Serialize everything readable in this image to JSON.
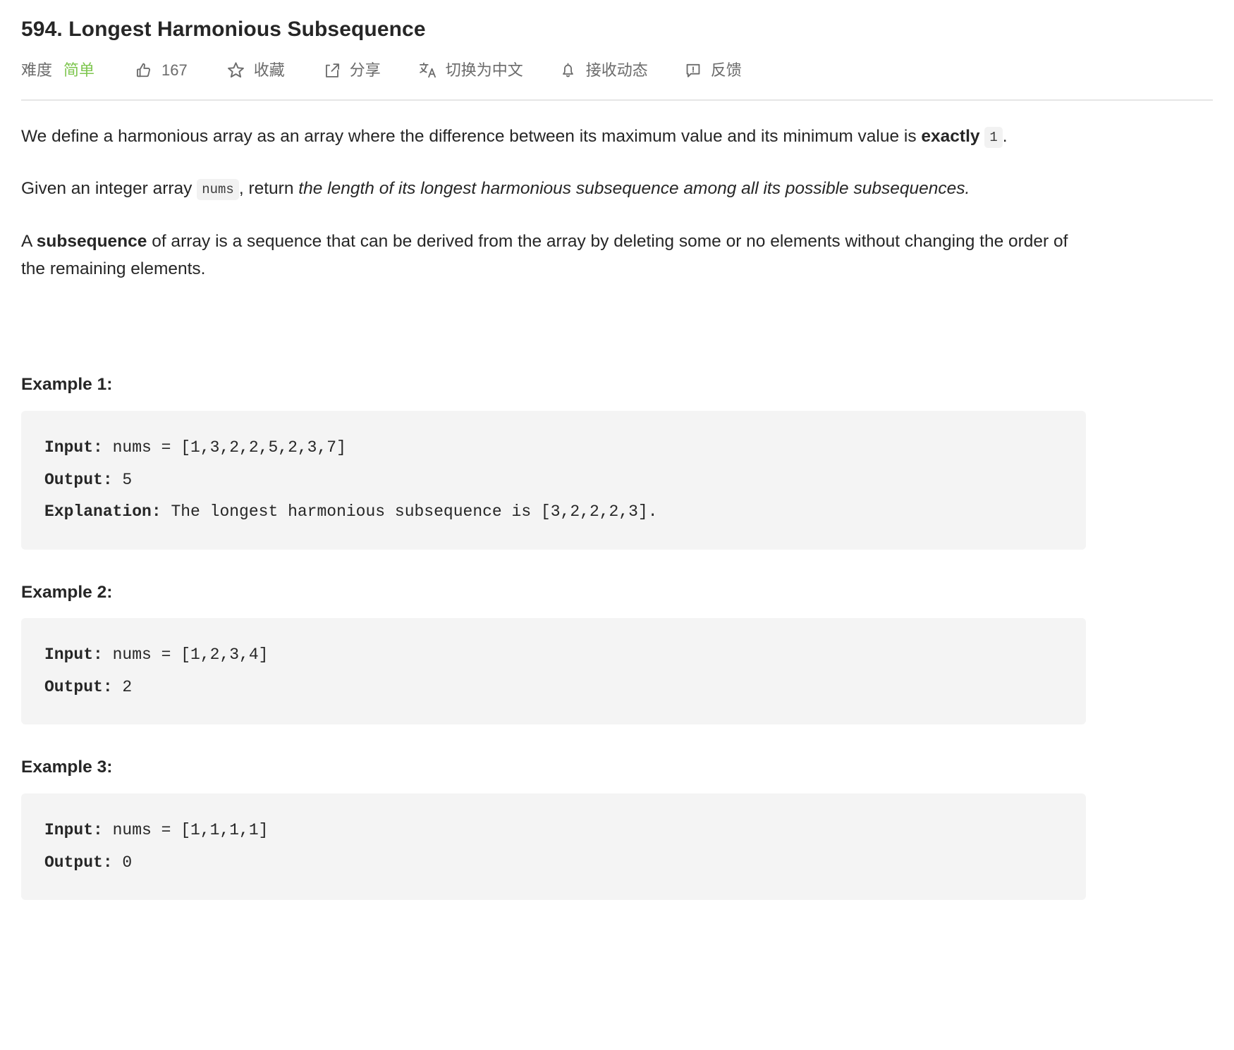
{
  "header": {
    "title": "594. Longest Harmonious Subsequence",
    "difficulty_label": "难度",
    "difficulty_value": "简单",
    "difficulty_color": "#7ec64f",
    "likes_count": "167",
    "favorite_label": "收藏",
    "share_label": "分享",
    "translate_label": "切换为中文",
    "subscribe_label": "接收动态",
    "feedback_label": "反馈",
    "icons": {
      "like": "thumbs-up-icon",
      "favorite": "star-icon",
      "share": "share-icon",
      "translate": "translate-icon",
      "subscribe": "bell-icon",
      "feedback": "feedback-icon"
    }
  },
  "content": {
    "paragraph_1_a": "We define a harmonious array as an array where the difference between its maximum value and its minimum value is ",
    "paragraph_1_bold": "exactly",
    "paragraph_1_code": "1",
    "paragraph_1_end": ".",
    "paragraph_2_a": "Given an integer array ",
    "paragraph_2_code": "nums",
    "paragraph_2_b": ", return ",
    "paragraph_2_em": "the length of its longest harmonious subsequence among all its possible subsequences.",
    "paragraph_3_a": "A ",
    "paragraph_3_bold": "subsequence",
    "paragraph_3_b": " of array is a sequence that can be derived from the array by deleting some or no elements without changing the order of the remaining elements."
  },
  "examples": [
    {
      "heading": "Example 1:",
      "input_label": "Input:",
      "input_value": " nums = [1,3,2,2,5,2,3,7]",
      "output_label": "Output:",
      "output_value": " 5",
      "explanation_label": "Explanation:",
      "explanation_value": " The longest harmonious subsequence is [3,2,2,2,3]."
    },
    {
      "heading": "Example 2:",
      "input_label": "Input:",
      "input_value": " nums = [1,2,3,4]",
      "output_label": "Output:",
      "output_value": " 2",
      "explanation_label": "",
      "explanation_value": ""
    },
    {
      "heading": "Example 3:",
      "input_label": "Input:",
      "input_value": " nums = [1,1,1,1]",
      "output_label": "Output:",
      "output_value": " 0",
      "explanation_label": "",
      "explanation_value": ""
    }
  ]
}
